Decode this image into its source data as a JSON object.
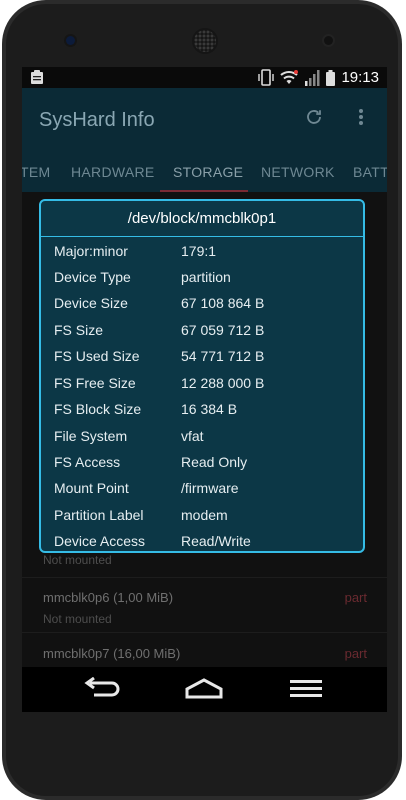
{
  "status_bar": {
    "time": "19:13"
  },
  "app": {
    "title": "SysHard Info"
  },
  "tabs": [
    {
      "label": "TEM"
    },
    {
      "label": "HARDWARE"
    },
    {
      "label": "STORAGE"
    },
    {
      "label": "NETWORK"
    },
    {
      "label": "BATT"
    }
  ],
  "list": [
    {
      "name": "mmcblk0p6 (1,00 MiB)",
      "status": "Not mounted",
      "type": "part"
    },
    {
      "name": "mmcblk0p7 (16,00 MiB)",
      "type": "part"
    }
  ],
  "list_partial": {
    "status_above": "Not mounted"
  },
  "dialog": {
    "title": "/dev/block/mmcblk0p1",
    "properties": [
      {
        "key": "Major:minor",
        "value": "179:1"
      },
      {
        "key": "Device Type",
        "value": "partition"
      },
      {
        "key": "Device Size",
        "value": "67 108 864 B"
      },
      {
        "key": "FS Size",
        "value": "67 059 712 B"
      },
      {
        "key": "FS Used Size",
        "value": "54 771 712 B"
      },
      {
        "key": "FS Free Size",
        "value": "12 288 000 B"
      },
      {
        "key": "FS Block Size",
        "value": "16 384 B"
      },
      {
        "key": "File System",
        "value": "vfat"
      },
      {
        "key": "FS Access",
        "value": "Read Only"
      },
      {
        "key": "Mount Point",
        "value": "/firmware"
      },
      {
        "key": "Partition Label",
        "value": "modem"
      },
      {
        "key": "Device Access",
        "value": "Read/Write"
      }
    ]
  },
  "colors": {
    "app_bar": "#0b2a36",
    "dialog_bg": "#0c3746",
    "dialog_border": "#35bce6",
    "tab_indicator": "#7a2a34"
  },
  "icons": {
    "status_left": "clipboard-icon",
    "refresh": "refresh-icon",
    "overflow": "overflow-menu-icon",
    "nav_back": "back-icon",
    "nav_home": "home-icon",
    "nav_recents": "menu-icon"
  }
}
